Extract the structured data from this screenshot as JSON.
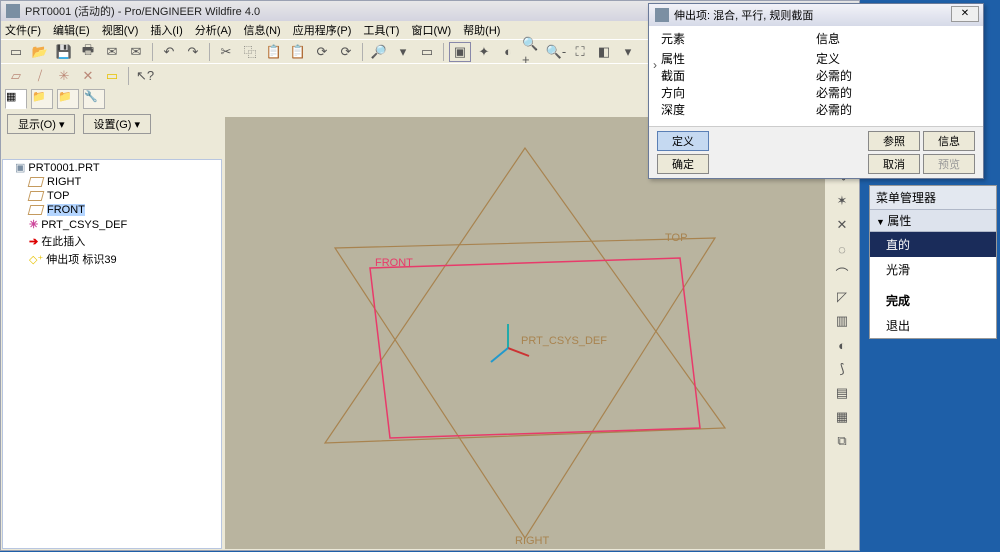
{
  "window": {
    "title": "PRT0001 (活动的) - Pro/ENGINEER Wildfire 4.0"
  },
  "menu": [
    "文件(F)",
    "编辑(E)",
    "视图(V)",
    "插入(I)",
    "分析(A)",
    "信息(N)",
    "应用程序(P)",
    "工具(T)",
    "窗口(W)",
    "帮助(H)"
  ],
  "dropdowns": {
    "show": "显示(O) ▾",
    "settings": "设置(G) ▾"
  },
  "tree": {
    "root": "PRT0001.PRT",
    "items": [
      {
        "label": "RIGHT",
        "type": "plane"
      },
      {
        "label": "TOP",
        "type": "plane"
      },
      {
        "label": "FRONT",
        "type": "plane",
        "selected": true
      },
      {
        "label": "PRT_CSYS_DEF",
        "type": "csys"
      },
      {
        "label": "在此插入",
        "type": "arrow"
      },
      {
        "label": "伸出项 标识39",
        "type": "ext"
      }
    ]
  },
  "viewport": {
    "labels": {
      "top": "TOP",
      "front": "FRONT",
      "right": "RIGHT",
      "csys": "PRT_CSYS_DEF"
    }
  },
  "dialog": {
    "title": "伸出项: 混合, 平行, 规则截面",
    "col1_header": "元素",
    "col2_header": "信息",
    "rows": [
      {
        "elem": "属性",
        "info": "定义"
      },
      {
        "elem": "截面",
        "info": "必需的"
      },
      {
        "elem": "方向",
        "info": "必需的"
      },
      {
        "elem": "深度",
        "info": "必需的"
      }
    ],
    "buttons": {
      "define": "定义",
      "ref": "参照",
      "info": "信息",
      "ok": "确定",
      "cancel": "取消",
      "preview": "预览"
    },
    "close": "✕"
  },
  "menu_manager": {
    "title": "菜单管理器",
    "section": "属性",
    "items": [
      {
        "label": "直的",
        "selected": true
      },
      {
        "label": "光滑"
      },
      {
        "label": "完成",
        "bold": true
      },
      {
        "label": "退出"
      }
    ]
  }
}
